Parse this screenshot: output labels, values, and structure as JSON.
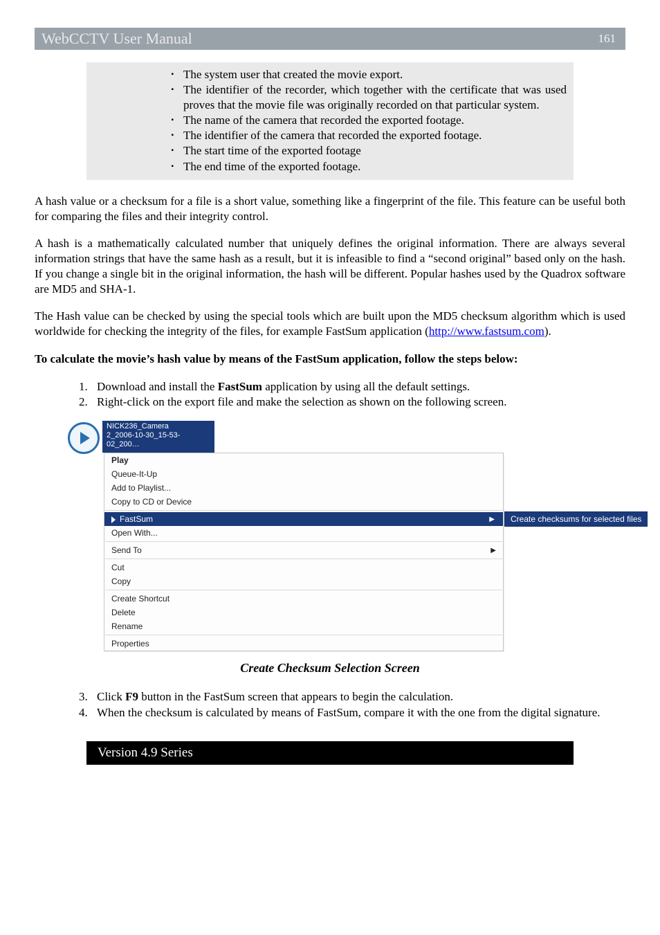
{
  "header": {
    "title": "WebCCTV User Manual",
    "page": "161"
  },
  "bullets": [
    "The system user that created the movie export.",
    "The identifier of the recorder, which together with the certificate that was used proves that the movie file was originally recorded on that particular system.",
    "The name of the camera that recorded the exported footage.",
    "The identifier of the camera that recorded the exported footage.",
    "The start time of the exported footage",
    "The end time of the exported footage."
  ],
  "para1": "A hash value or a checksum for a file is a short value, something like a fingerprint of the file. This feature can be useful both for comparing the files and their integrity control.",
  "para2": "A hash is a mathematically calculated number that uniquely defines the original information. There are always several information strings that have the same hash as a result, but it is infeasible to find a “second original” based only on the hash. If you change a single bit in the original information, the hash will be different. Popular hashes used by the Quadrox software are MD5 and SHA-1.",
  "para3_pre": "The Hash value can be checked by using the special tools which are built upon the MD5 checksum algorithm which is used worldwide for checking the integrity of the files, for example FastSum application (",
  "para3_link": "http://www.fastsum.com",
  "para3_post": ").",
  "para4": "To calculate the movie’s hash value by means of the FastSum application, follow the steps below:",
  "steps12": [
    {
      "n": "1.",
      "pre": "Download and install the ",
      "bold": "FastSum",
      "post": " application by using all the default settings."
    },
    {
      "n": "2.",
      "text": "Right-click on the export file and make the selection as shown on the following screen."
    }
  ],
  "file": {
    "line1": "NICK236_Camera",
    "line2": "2_2006-10-30_15-53-02_200…"
  },
  "ctx": {
    "play": "Play",
    "queue": "Queue-It-Up",
    "addpl": "Add to Playlist...",
    "copycd": "Copy to CD or Device",
    "fastsum": "FastSum",
    "openwith": "Open With...",
    "sendto": "Send To",
    "cut": "Cut",
    "copy": "Copy",
    "shortcut": "Create Shortcut",
    "delete": "Delete",
    "rename": "Rename",
    "props": "Properties"
  },
  "submenu_label": "Create checksums for selected files",
  "caption": "Create Checksum Selection Screen",
  "steps34": [
    {
      "n": "3.",
      "pre": "Click ",
      "bold": "F9",
      "post": " button in the FastSum screen that appears to begin the calculation."
    },
    {
      "n": "4.",
      "text": "When the checksum is calculated by means of FastSum, compare it with the one from the digital signature."
    }
  ],
  "footer": "Version 4.9 Series"
}
